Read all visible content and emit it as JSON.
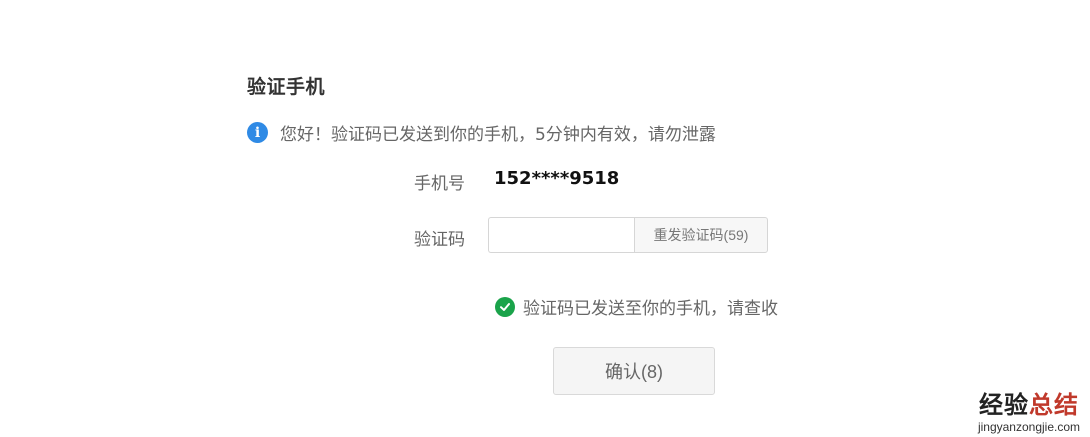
{
  "page_title": "验证手机",
  "notice": {
    "icon": "info-icon",
    "text": "您好！验证码已发送到你的手机，5分钟内有效，请勿泄露"
  },
  "phone": {
    "label": "手机号",
    "value": "152****9518"
  },
  "code": {
    "label": "验证码",
    "value": "",
    "placeholder": "",
    "resend_label": "重发验证码(59)"
  },
  "success": {
    "icon": "check-circle-icon",
    "text": "验证码已发送至你的手机，请查收"
  },
  "confirm_label": "确认(8)",
  "watermark": {
    "title_part1": "经验",
    "title_part2": "总结",
    "url": "jingyanzongjie.com"
  },
  "colors": {
    "info_blue": "#2f8ae5",
    "success_green": "#1aa34a",
    "watermark_red": "#c0392b"
  }
}
